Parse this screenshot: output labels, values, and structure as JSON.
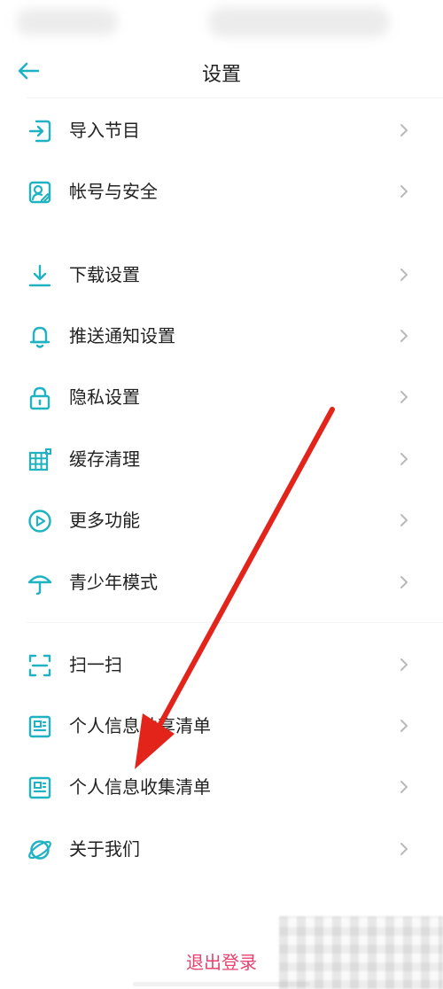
{
  "header": {
    "title": "设置",
    "back_icon": "arrow-left-icon"
  },
  "colors": {
    "accent": "#1fb2c3",
    "logout": "#e8426e",
    "annotation_arrow": "#e3241b"
  },
  "settings": {
    "group1": [
      {
        "label": "导入节目",
        "icon": "import-icon"
      },
      {
        "label": "帐号与安全",
        "icon": "account-security-icon"
      }
    ],
    "group2": [
      {
        "label": "下载设置",
        "icon": "download-icon"
      },
      {
        "label": "推送通知设置",
        "icon": "bell-icon"
      },
      {
        "label": "隐私设置",
        "icon": "lock-icon"
      },
      {
        "label": "缓存清理",
        "icon": "cache-grid-icon"
      },
      {
        "label": "更多功能",
        "icon": "play-circle-icon"
      },
      {
        "label": "青少年模式",
        "icon": "umbrella-icon"
      }
    ],
    "group3": [
      {
        "label": "扫一扫",
        "icon": "scan-icon"
      },
      {
        "label": "个人信息共享清单",
        "icon": "document-list-icon"
      },
      {
        "label": "个人信息收集清单",
        "icon": "document-list-icon"
      },
      {
        "label": "关于我们",
        "icon": "planet-icon"
      }
    ]
  },
  "footer": {
    "logout_label": "退出登录"
  }
}
